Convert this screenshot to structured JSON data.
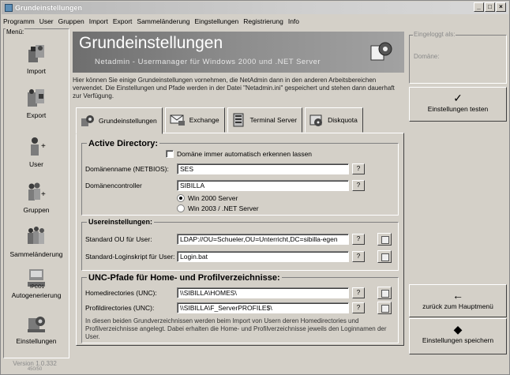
{
  "window": {
    "title": "Grundeinstellungen"
  },
  "menu": [
    "Programm",
    "User",
    "Gruppen",
    "Import",
    "Export",
    "Sammeländerung",
    "Eingstellungen",
    "Registrierung",
    "Info"
  ],
  "leftnav": {
    "caption": "Menü:",
    "items": [
      "Import",
      "Export",
      "User",
      "Gruppen",
      "Sammeländerung",
      "Autogenerierung",
      "Einstellungen"
    ],
    "icon_badge": "IPCO1",
    "version": "Version 1.0.332",
    "version_sub": "450/50"
  },
  "header": {
    "title": "Grundeinstellungen",
    "subtitle": "Netadmin - Usermanager für Windows 2000 und .NET Server",
    "intro": "Hier können Sie einige Grundeinstellungen vornehmen, die NetAdmin dann in den anderen Arbeitsbereichen verwendet. Die Einstellungen und Pfade werden in der Datei \"Netadmin.ini\" gespeichert und stehen dann dauerhaft zur Verfügung."
  },
  "tabs": [
    "Grundeinstellungen",
    "Exchange",
    "Terminal Server",
    "Diskquota"
  ],
  "active_directory": {
    "title": "Active Directory:",
    "checkbox_label": "Domäne immer automatisch erkennen lassen",
    "domain_label": "Domänenname (NETBIOS):",
    "domain_value": "SES",
    "dc_label": "Domänencontroller",
    "dc_value": "SIBILLA",
    "radio_2000": "Win 2000 Server",
    "radio_2003": "Win 2003 / .NET Server",
    "help": "?"
  },
  "user_settings": {
    "title": "Usereinstellungen:",
    "ou_label": "Standard OU für User:",
    "ou_value": "LDAP://OU=Schueler,OU=Unterricht,DC=sibilla-egen",
    "login_label": "Standard-Loginskript für User:",
    "login_value": "Login.bat"
  },
  "unc": {
    "title": "UNC-Pfade für Home- und Profilverzeichnisse:",
    "home_label": "Homedirectories (UNC):",
    "home_value": "\\\\SIBILLA\\HOMES\\",
    "profile_label": "Profildirectories (UNC):",
    "profile_value": "\\\\SIBILLA\\F_ServerPROFILE$\\",
    "note": "In diesen beiden Grundverzeichnissen werden beim Import von Usern deren Homedirectories und Profilverzeichnisse angelegt. Dabei erhalten die Home- und Profilverzeichnisse jeweils den Loginnamen der User."
  },
  "right": {
    "logged_in": "Eingeloggt als:",
    "domain": "Domäne:",
    "test_button": "Einstellungen testen",
    "back_button": "zurück zum Hauptmenü",
    "save_button": "Einstellungen speichern"
  }
}
